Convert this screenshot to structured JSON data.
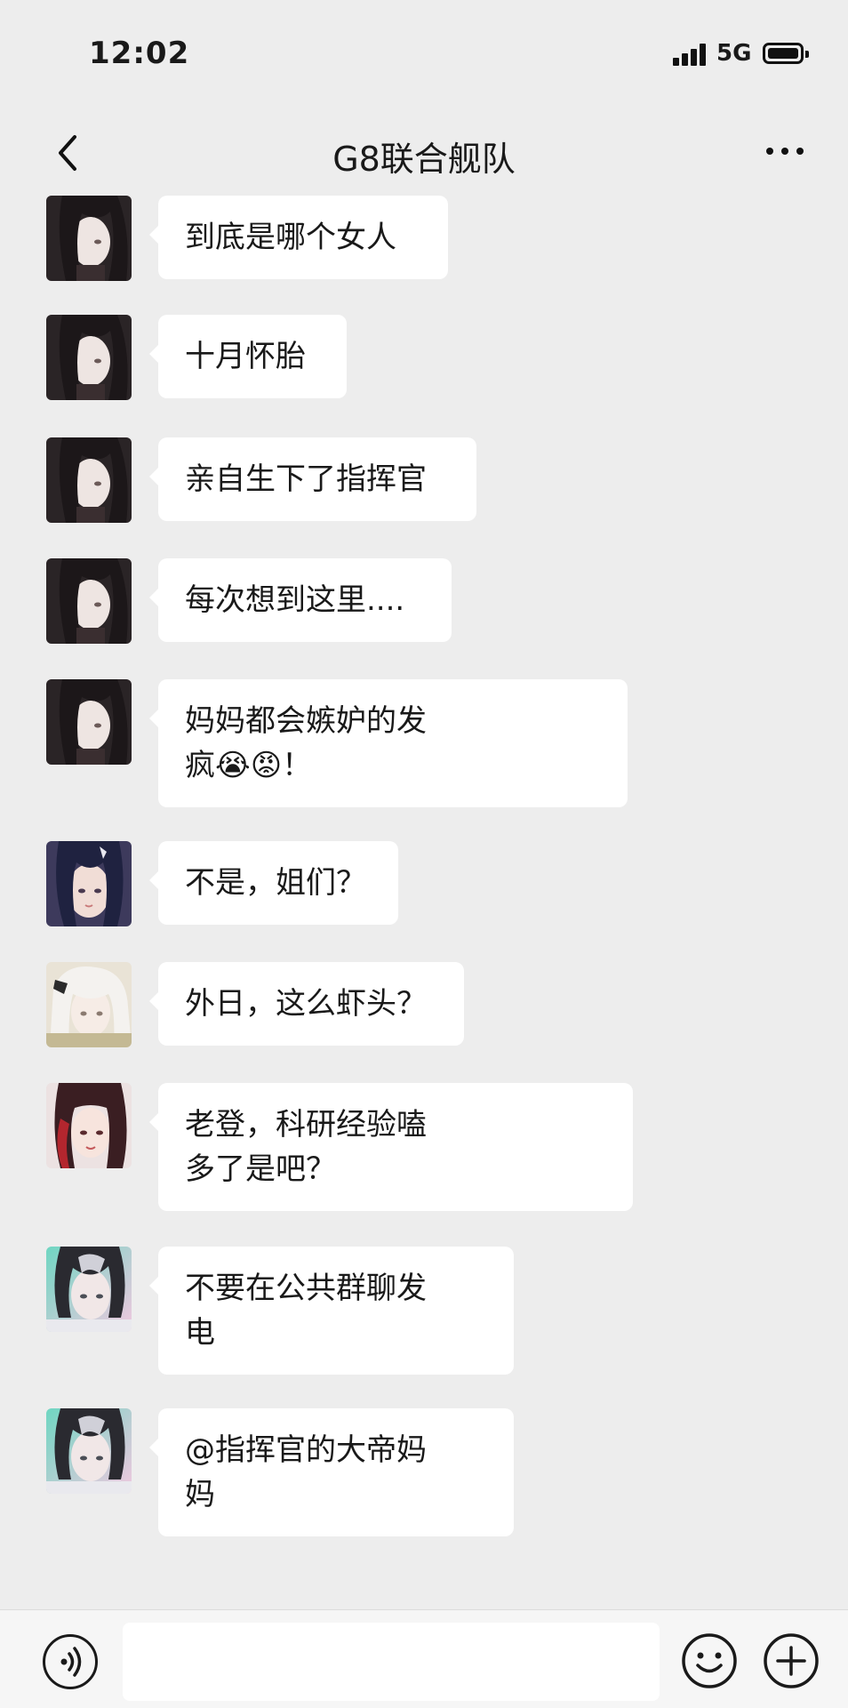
{
  "status_bar": {
    "time": "12:02",
    "network": "5G"
  },
  "nav": {
    "title": "G8联合舰队",
    "back_icon": "chevron-left-icon",
    "more_icon": "more-dots-icon"
  },
  "messages": [
    {
      "text": "到底是哪个女人",
      "avatar": "dark-hair-girl"
    },
    {
      "text": "十月怀胎",
      "avatar": "dark-hair-girl"
    },
    {
      "text": "亲自生下了指挥官",
      "avatar": "dark-hair-girl"
    },
    {
      "text": "每次想到这里....",
      "avatar": "dark-hair-girl"
    },
    {
      "text": "妈妈都会嫉妒的发\n疯😭😡！",
      "avatar": "dark-hair-girl"
    },
    {
      "text": "不是，姐们？",
      "avatar": "navy-hair-girl"
    },
    {
      "text": "外日，这么虾头？",
      "avatar": "white-hair-girl"
    },
    {
      "text": "老登，科研经验嗑\n多了是吧？",
      "avatar": "red-hair-girl"
    },
    {
      "text": "不要在公共群聊发\n电",
      "avatar": "silver-green-hair-girl"
    },
    {
      "text": "@指挥官的大帝妈\n妈",
      "avatar": "silver-green-hair-girl"
    }
  ],
  "input_bar": {
    "placeholder": "",
    "voice_icon": "voice-icon",
    "emoji_icon": "emoji-icon",
    "plus_icon": "plus-icon"
  },
  "colors": {
    "background": "#ededed",
    "bubble": "#ffffff",
    "text": "#191919"
  }
}
